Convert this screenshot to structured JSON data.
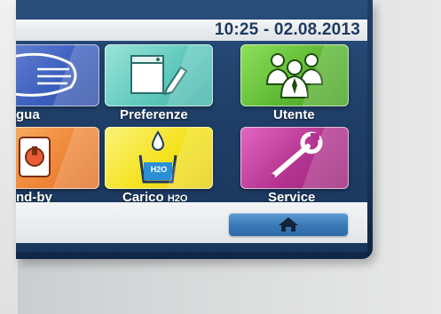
{
  "header": {
    "time": "10:25 - 02.",
    "date_bold": "08.2013"
  },
  "tiles": [
    {
      "label": "gua",
      "color": "#3b5fbd"
    },
    {
      "label": "Preferenze",
      "color": "#5fc9bd"
    },
    {
      "label": "Utente",
      "color": "#5db833"
    },
    {
      "label": "nd-by",
      "color": "#f08a3c"
    },
    {
      "label": "Carico H2O",
      "label_main": "Carico",
      "label_sub": "H2O",
      "icon_text": "H2O",
      "color": "#f4e21c"
    },
    {
      "label": "Service",
      "color": "#b3348f"
    }
  ],
  "footer": {
    "home_icon": "home-icon"
  }
}
